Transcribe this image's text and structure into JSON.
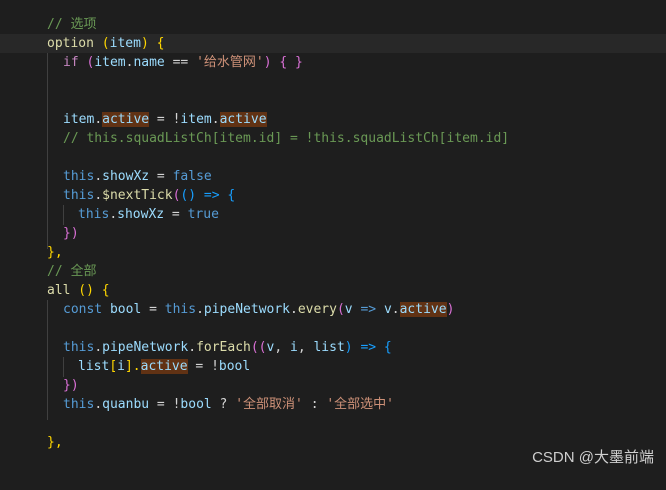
{
  "editor": {
    "lines": [
      {
        "c1": "// ",
        "c2": "选项"
      },
      {
        "k": "option",
        "b1": " (",
        "v": "item",
        "b2": ") {"
      },
      {
        "kw": "if",
        "p1": " (",
        "v1": "item",
        "d1": ".",
        "v2": "name",
        "op": " == ",
        "s": "'给水管网'",
        "p2": ") { }"
      },
      {},
      {},
      {
        "v1": "item",
        "d1": ".",
        "hv1": "active",
        "op": " = !",
        "v2": "item",
        "d2": ".",
        "hv2": "active"
      },
      {
        "c": "// this.squadListCh[item.id] = !this.squadListCh[item.id]"
      },
      {},
      {
        "t": "this",
        "d": ".",
        "v": "showXz",
        "op": " = ",
        "b": "false"
      },
      {
        "t": "this",
        "d": ".",
        "f": "$nextTick",
        "p1": "(",
        "p2": "() => {"
      },
      {
        "t": "this",
        "d": ".",
        "v": "showXz",
        "op": " = ",
        "b": "true"
      },
      {
        "p": "})"
      },
      {
        "p": "},"
      },
      {
        "c1": "// ",
        "c2": "全部"
      },
      {
        "k": "all",
        "b": " () {"
      },
      {
        "kw": "const",
        "v": " bool",
        "op": " = ",
        "t": "this",
        "d1": ".",
        "v2": "pipeNetwork",
        "d2": ".",
        "f": "every",
        "p1": "(",
        "v3": "v",
        "ar": " => ",
        "v4": "v",
        "d3": ".",
        "hv": "active",
        "p2": ")"
      },
      {},
      {
        "t": "this",
        "d1": ".",
        "v": "pipeNetwork",
        "d2": ".",
        "f": "forEach",
        "p1": "((",
        "v2": "v",
        "cm1": ", ",
        "v3": "i",
        "cm2": ", ",
        "v4": "list",
        "p2": ") => {"
      },
      {
        "v": "list",
        "p1": "[",
        "v2": "i",
        "p2": "].",
        "hv": "active",
        "op": " = !",
        "v3": "bool"
      },
      {
        "p": "})"
      },
      {
        "t": "this",
        "d": ".",
        "v": "quanbu",
        "op": " = !",
        "v2": "bool",
        "q": " ? ",
        "s1": "'全部取消'",
        "col": " : ",
        "s2": "'全部选中'"
      },
      {},
      {},
      {
        "p": "},"
      }
    ]
  },
  "watermark": "CSDN @大墨前端"
}
